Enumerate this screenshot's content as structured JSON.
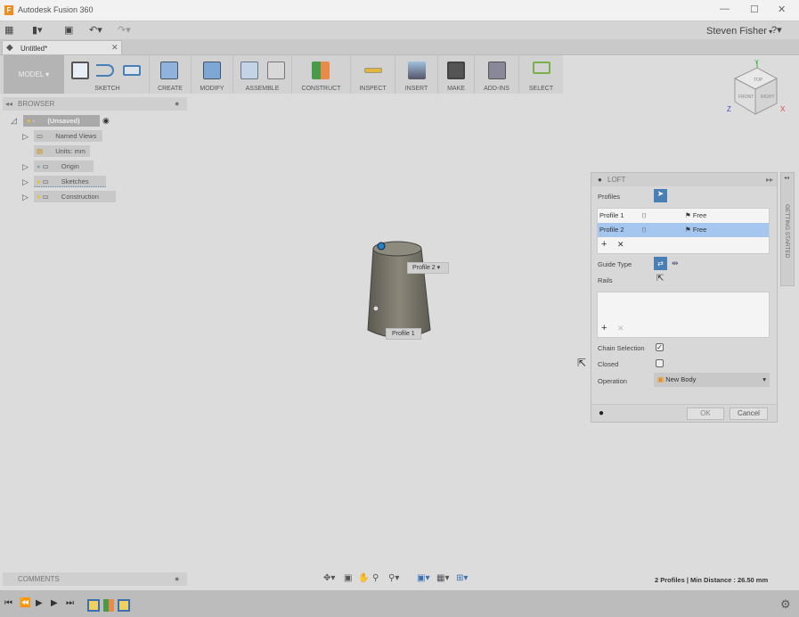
{
  "app": {
    "title": "Autodesk Fusion 360",
    "user": "Steven Fisher",
    "help": "?"
  },
  "document_tab": {
    "label": "Untitled*"
  },
  "ribbon": {
    "workspace": "MODEL",
    "groups": [
      "SKETCH",
      "CREATE",
      "MODIFY",
      "ASSEMBLE",
      "CONSTRUCT",
      "INSPECT",
      "INSERT",
      "MAKE",
      "ADD-INS",
      "SELECT"
    ]
  },
  "viewcube": {
    "faces": [
      "TOP",
      "FRONT",
      "RIGHT"
    ],
    "axes": [
      "Y",
      "Z",
      "X"
    ]
  },
  "browser": {
    "title": "BROWSER",
    "root": "(Unsaved)",
    "items": [
      "Named Views",
      "Units: mm",
      "Origin",
      "Sketches",
      "Construction"
    ]
  },
  "comments": {
    "title": "COMMENTS"
  },
  "viewport": {
    "labels": [
      "Profile 2",
      "Profile 1"
    ]
  },
  "loft": {
    "title": "LOFT",
    "profiles_label": "Profiles",
    "profiles": [
      {
        "name": "Profile 1",
        "condition": "Free",
        "selected": false
      },
      {
        "name": "Profile 2",
        "condition": "Free",
        "selected": true
      }
    ],
    "guide_type_label": "Guide Type",
    "rails_label": "Rails",
    "chain_selection_label": "Chain Selection",
    "chain_selection": true,
    "closed_label": "Closed",
    "closed": false,
    "operation_label": "Operation",
    "operation": "New Body",
    "ok": "OK",
    "cancel": "Cancel"
  },
  "getting_started": "GETTING STARTED",
  "status": "2 Profiles | Min Distance : 26.50 mm",
  "colors": {
    "accent": "#4a7fb5",
    "selection": "#a4c6ef"
  }
}
